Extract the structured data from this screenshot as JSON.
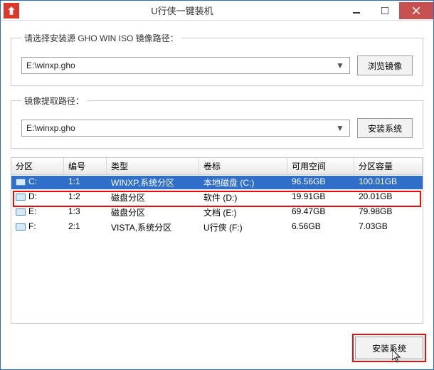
{
  "title": "U行侠一键装机",
  "group1": {
    "legend": "请选择安装源 GHO WIN ISO 镜像路径：",
    "value": "E:\\winxp.gho",
    "button": "浏览镜像"
  },
  "group2": {
    "legend": "镜像提取路径：",
    "value": "E:\\winxp.gho",
    "button": "安装系统"
  },
  "table": {
    "headers": [
      "分区",
      "编号",
      "类型",
      "卷标",
      "可用空间",
      "分区容量"
    ],
    "rows": [
      {
        "drive": "C:",
        "num": "1:1",
        "type": "WINXP,系统分区",
        "label": "本地磁盘 (C:)",
        "free": "96.56GB",
        "size": "100.01GB",
        "selected": true
      },
      {
        "drive": "D:",
        "num": "1:2",
        "type": "磁盘分区",
        "label": "软件 (D:)",
        "free": "19.91GB",
        "size": "20.01GB",
        "selected": false
      },
      {
        "drive": "E:",
        "num": "1:3",
        "type": "磁盘分区",
        "label": "文档 (E:)",
        "free": "69.47GB",
        "size": "79.98GB",
        "selected": false
      },
      {
        "drive": "F:",
        "num": "2:1",
        "type": "VISTA,系统分区",
        "label": "U行侠 (F:)",
        "free": "6.56GB",
        "size": "7.03GB",
        "selected": false
      }
    ]
  },
  "footer": {
    "install": "安装系统"
  }
}
